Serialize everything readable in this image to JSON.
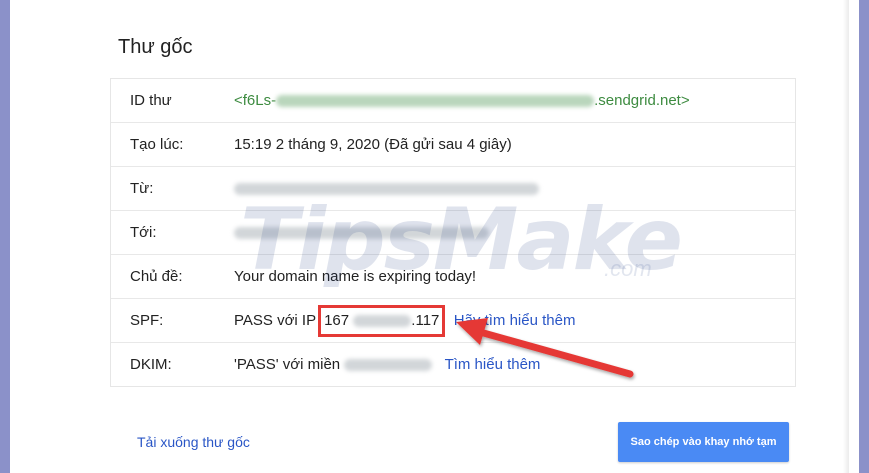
{
  "page": {
    "title": "Thư gốc"
  },
  "rows": [
    {
      "label": "ID thư",
      "value_prefix": "<f6Ls-",
      "value_suffix": ".sendgrid.net>"
    },
    {
      "label": "Tạo lúc:",
      "value": "15:19 2 tháng 9, 2020 (Đã gửi sau 4 giây)"
    },
    {
      "label": "Từ:"
    },
    {
      "label": "Tới:"
    },
    {
      "label": "Chủ đề:",
      "value": "Your domain name is expiring today!"
    },
    {
      "label": "SPF:",
      "value_prefix": "PASS với IP",
      "ip_start": "167",
      "ip_end": ".117",
      "link": "Hãy tìm hiểu thêm"
    },
    {
      "label": "DKIM:",
      "value_prefix": "'PASS' với miền",
      "link": "Tìm hiểu thêm"
    }
  ],
  "footer": {
    "download_label": "Tải xuống thư gốc",
    "copy_label": "Sao chép vào khay nhớ tạm"
  },
  "watermark": {
    "brand": "TipsMake",
    "suffix": ".com"
  },
  "colors": {
    "frame": "#8b91c9",
    "link": "#2a56c6",
    "message_id": "#3d8b40",
    "highlight_box": "#e53935",
    "button": "#4a8af4"
  }
}
